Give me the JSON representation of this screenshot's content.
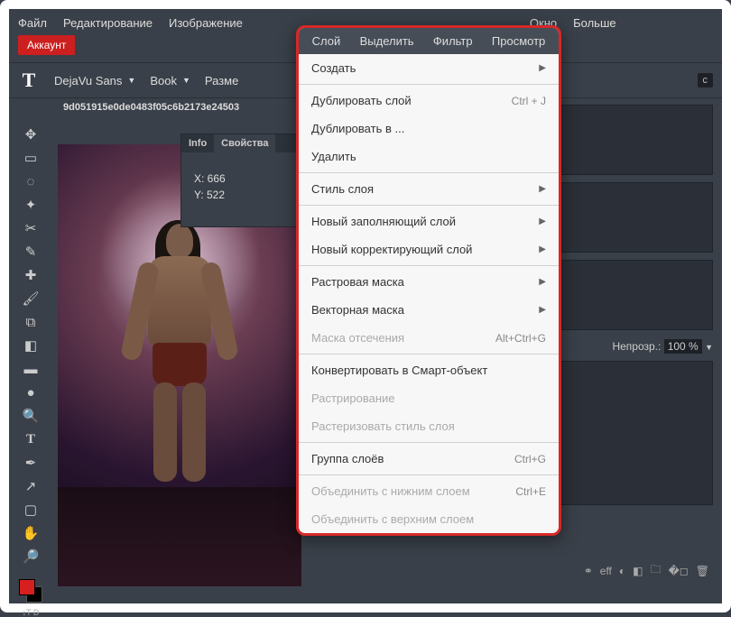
{
  "menubar": {
    "file": "Файл",
    "edit": "Редактирование",
    "image": "Изображение",
    "layer": "Слой",
    "select": "Выделить",
    "filter": "Фильтр",
    "view": "Просмотр",
    "window": "Окно",
    "more": "Больше"
  },
  "account_button": "Аккаунт",
  "type_toolbar": {
    "font": "DejaVu Sans",
    "weight": "Book",
    "size_label": "Разме"
  },
  "document_tab": "9d051915e0de0483f05c6b2173e24503",
  "tab_right_marker": "> < ",
  "info_panel": {
    "tab_info": "Info",
    "tab_props": "Свойства",
    "x_label": "X: 666",
    "y_label": "Y: 522"
  },
  "dropdown": {
    "header": {
      "layer": "Слой",
      "select": "Выделить",
      "filter": "Фильтр",
      "view": "Просмотр"
    },
    "create": "Создать",
    "duplicate_layer": "Дублировать слой",
    "duplicate_layer_sc": "Ctrl + J",
    "duplicate_into": "Дублировать в ...",
    "delete": "Удалить",
    "layer_style": "Стиль слоя",
    "new_fill": "Новый заполняющий слой",
    "new_adj": "Новый корректирующий слой",
    "raster_mask": "Растровая маска",
    "vector_mask": "Векторная маска",
    "clip_mask": "Маска отсечения",
    "clip_mask_sc": "Alt+Ctrl+G",
    "to_smart": "Конвертировать в Смарт-объект",
    "rasterize": "Растрирование",
    "rasterize_style": "Растеризовать стиль слоя",
    "group": "Группа слоёв",
    "group_sc": "Ctrl+G",
    "merge_down": "Объединить с нижним слоем",
    "merge_down_sc": "Ctrl+E",
    "merge_up": "Объединить с верхним слоем"
  },
  "right_panel": {
    "opacity_label": "Непрозр.:",
    "opacity_value": "100 %"
  },
  "right_corner": "c",
  "footer_icons": {
    "link": "⚭",
    "fx": "eff",
    "contrast": "◐",
    "mask": "◧",
    "folder": "🗀",
    "new": "�◻",
    "trash": "🗑"
  }
}
